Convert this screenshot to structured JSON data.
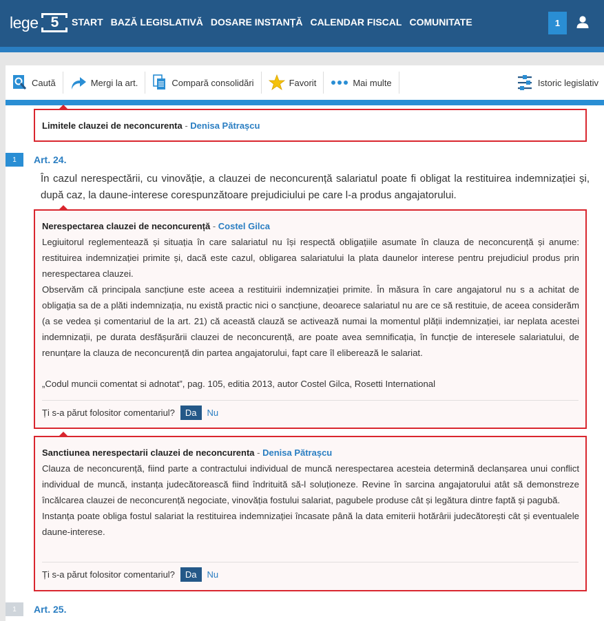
{
  "header": {
    "logo_text": "lege",
    "logo_number": "5",
    "nav": [
      "START",
      "BAZĂ LEGISLATIVĂ",
      "DOSARE INSTANȚĂ",
      "CALENDAR FISCAL",
      "COMUNITATE"
    ],
    "notification_count": "1"
  },
  "toolbar": {
    "search": "Caută",
    "goto": "Mergi la art.",
    "compare": "Compară consolidări",
    "favorite": "Favorit",
    "more": "Mai multe",
    "history": "Istoric legislativ"
  },
  "comment_top": {
    "title": "Limitele clauzei de neconcurenta",
    "separator": " - ",
    "author": "Denisa Pătrașcu"
  },
  "article_24": {
    "badge": "1",
    "title": "Art. 24.",
    "text": "În cazul nerespectării, cu vinovăție, a clauzei de neconcurență salariatul poate fi obligat la restituirea indemnizației și, după caz, la daune-interese corespunzătoare prejudiciului pe care l-a produs angajatorului."
  },
  "comment_1": {
    "title": "Nerespectarea clauzei de neconcurență",
    "separator": " - ",
    "author": "Costel Gilca",
    "paragraph_1": "Legiuitorul reglementează și situația în care salariatul nu își respectă obligațiile asumate în clauza de neconcurență și anume: restituirea indemnizației primite și, dacă este cazul, obligarea salariatului la plata daunelor interese pentru prejudiciul produs prin nerespectarea clauzei.",
    "paragraph_2": "Observăm că principala sancțiune este aceea a restituirii indemnizației primite. În măsura în care angajatorul nu s a achitat de obligația sa de a plăti indemnizația, nu există practic nici o sancțiune, deoarece salariatul nu are ce să restituie, de aceea considerăm (a se vedea și comentariul de la art. 21) că această clauză se activează numai la momentul plății indemnizației, iar neplata acestei indemnizații, pe durata desfășurării clauzei de neconcurență, are poate avea semnificația, în funcție de interesele salariatului, de renunțare la clauza de neconcurență din partea angajatorului, fapt care îl eliberează le salariat.",
    "source": "„Codul muncii comentat si adnotat”, pag. 105, editia 2013, autor Costel Gilca, Rosetti International",
    "question": "Ți s-a părut folositor comentariul?",
    "yes": "Da",
    "no": "Nu"
  },
  "comment_2": {
    "title": "Sanctiunea nerespectarii clauzei de neconcurenta",
    "separator": " - ",
    "author": "Denisa Pătrașcu",
    "paragraph_1": "Clauza de neconcurență, fiind parte a contractului individual de muncă nerespectarea acesteia determină declanșarea unui conflict individual de muncă, instanța judecătorească fiind îndrituită să-l soluționeze. Revine în sarcina angajatorului atât să demonstreze încălcarea clauzei de neconcurență negociate, vinovăția fostului salariat, pagubele produse cât și legătura dintre faptă și pagubă.",
    "paragraph_2": "Instanța poate obliga fostul salariat la restituirea indemnizației încasate până la data emiterii hotărârii judecătorești cât și eventualele daune-interese.",
    "question": "Ți s-a părut folositor comentariul?",
    "yes": "Da",
    "no": "Nu"
  },
  "article_25": {
    "badge": "1",
    "title": "Art. 25."
  },
  "colors": {
    "header_bg": "#245888",
    "accent_blue": "#2a8ed4",
    "link_blue": "#2a7ec2",
    "comment_border": "#d9262e"
  },
  "icons": [
    "search-icon",
    "arrow-icon",
    "documents-icon",
    "star-icon",
    "dots-icon",
    "timeline-icon",
    "user-icon"
  ]
}
